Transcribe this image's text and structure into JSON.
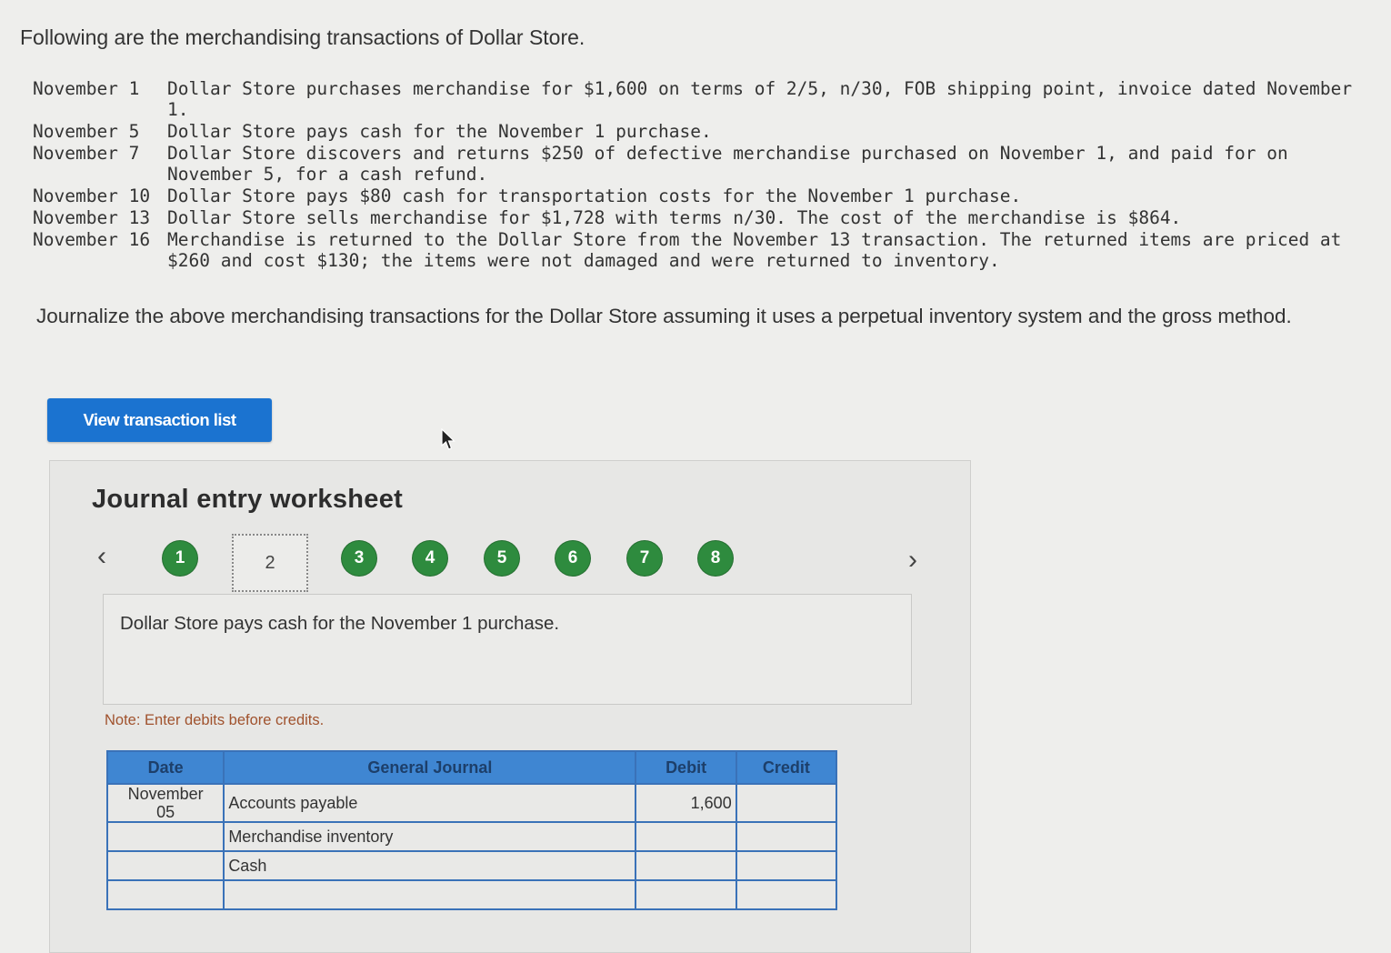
{
  "intro": "Following are the merchandising transactions of Dollar Store.",
  "transactions": [
    {
      "date": "November 1",
      "text": "Dollar Store purchases merchandise for $1,600 on terms of 2/5, n/30, FOB shipping point, invoice dated November 1."
    },
    {
      "date": "November 5",
      "text": "Dollar Store pays cash for the November 1 purchase."
    },
    {
      "date": "November 7",
      "text": "Dollar Store discovers and returns $250 of defective merchandise purchased on November 1, and paid for on November 5, for a cash refund."
    },
    {
      "date": "November 10",
      "text": "Dollar Store pays $80 cash for transportation costs for the November 1 purchase."
    },
    {
      "date": "November 13",
      "text": "Dollar Store sells merchandise for $1,728 with terms n/30. The cost of the merchandise is $864."
    },
    {
      "date": "November 16",
      "text": "Merchandise is returned to the Dollar Store from the November 13 transaction. The returned items are priced at $260 and cost $130; the items were not damaged and were returned to inventory."
    }
  ],
  "instructions": "Journalize the above merchandising transactions for the Dollar Store assuming it uses a perpetual inventory system and the gross method.",
  "view_button": "View transaction list",
  "worksheet": {
    "title": "Journal entry worksheet",
    "prev_icon": "chevron-left-icon",
    "next_icon": "chevron-right-icon",
    "steps": [
      "1",
      "2",
      "3",
      "4",
      "5",
      "6",
      "7",
      "8"
    ],
    "current_step": "2",
    "description": "Dollar Store pays cash for the November 1 purchase.",
    "note": "Note: Enter debits before credits.",
    "columns": {
      "date": "Date",
      "journal": "General Journal",
      "debit": "Debit",
      "credit": "Credit"
    },
    "rows": [
      {
        "date": "November\n05",
        "account": "Accounts payable",
        "debit": "1,600",
        "credit": ""
      },
      {
        "date": "",
        "account": "Merchandise inventory",
        "debit": "",
        "credit": ""
      },
      {
        "date": "",
        "account": "Cash",
        "debit": "",
        "credit": ""
      },
      {
        "date": "",
        "account": "",
        "debit": "",
        "credit": ""
      }
    ]
  },
  "colors": {
    "step_complete": "#2e8b3e",
    "button": "#1b73d0",
    "table_header": "#3f86d2",
    "note": "#a0522d"
  }
}
